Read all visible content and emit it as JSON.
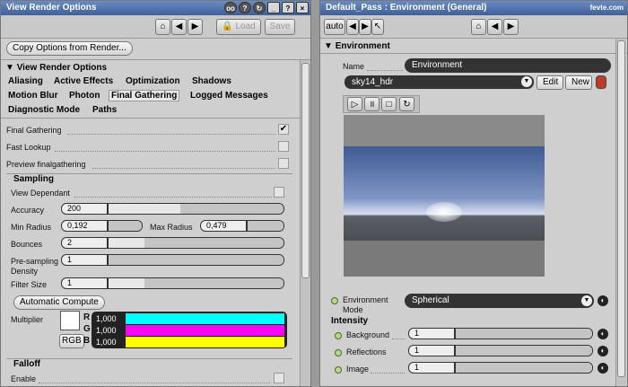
{
  "left": {
    "title": "View Render Options",
    "toolbar": {
      "load": "Load",
      "save": "Save"
    },
    "copy_button": "Copy Options from Render...",
    "section_title": "View Render Options",
    "tabs_row1": [
      "Aliasing",
      "Active Effects",
      "Optimization",
      "Shadows"
    ],
    "tabs_row2": [
      "Motion Blur",
      "Photon",
      "Final Gathering",
      "Logged Messages"
    ],
    "tabs_row3": [
      "Diagnostic Mode",
      "Paths"
    ],
    "active_tab": "Final Gathering",
    "final_gathering": "Final Gathering",
    "final_gathering_checked": true,
    "fast_lookup": "Fast Lookup",
    "preview_fg": "Preview finalgathering",
    "sampling_title": "Sampling",
    "view_dependant": "View Dependant",
    "accuracy_label": "Accuracy",
    "accuracy_value": "200",
    "min_radius_label": "Min Radius",
    "min_radius_value": "0,192",
    "max_radius_label": "Max Radius",
    "max_radius_value": "0,479",
    "bounces_label": "Bounces",
    "bounces_value": "2",
    "presampling_label": "Pre-sampling",
    "presampling_label2": "Density",
    "presampling_value": "1",
    "filter_label": "Filter Size",
    "filter_value": "1",
    "auto_compute": "Automatic Compute",
    "multiplier_label": "Multiplier",
    "rgb_button": "RGB",
    "r_label": "R",
    "g_label": "G",
    "b_label": "B",
    "r_value": "1,000",
    "g_value": "1,000",
    "b_value": "1,000",
    "falloff_title": "Falloff",
    "enable_label": "Enable"
  },
  "right": {
    "title": "Default_Pass : Environment (General)",
    "auto": "auto",
    "section_title": "Environment",
    "name_label": "Name",
    "name_value": "Environment",
    "image_select": "sky14_hdr",
    "edit_button": "Edit",
    "new_button": "New",
    "env_mode_label": "Environment",
    "env_mode_label2": "Mode",
    "env_mode_value": "Spherical",
    "intensity_title": "Intensity",
    "background_label": "Background",
    "background_value": "1",
    "reflections_label": "Reflections",
    "reflections_value": "1",
    "image_label": "Image",
    "image_value": "1"
  },
  "colors": {
    "title_bar": "#4a6ea8",
    "cyan": "#00ffff",
    "magenta": "#ff00ff",
    "yellow": "#ffff00"
  }
}
